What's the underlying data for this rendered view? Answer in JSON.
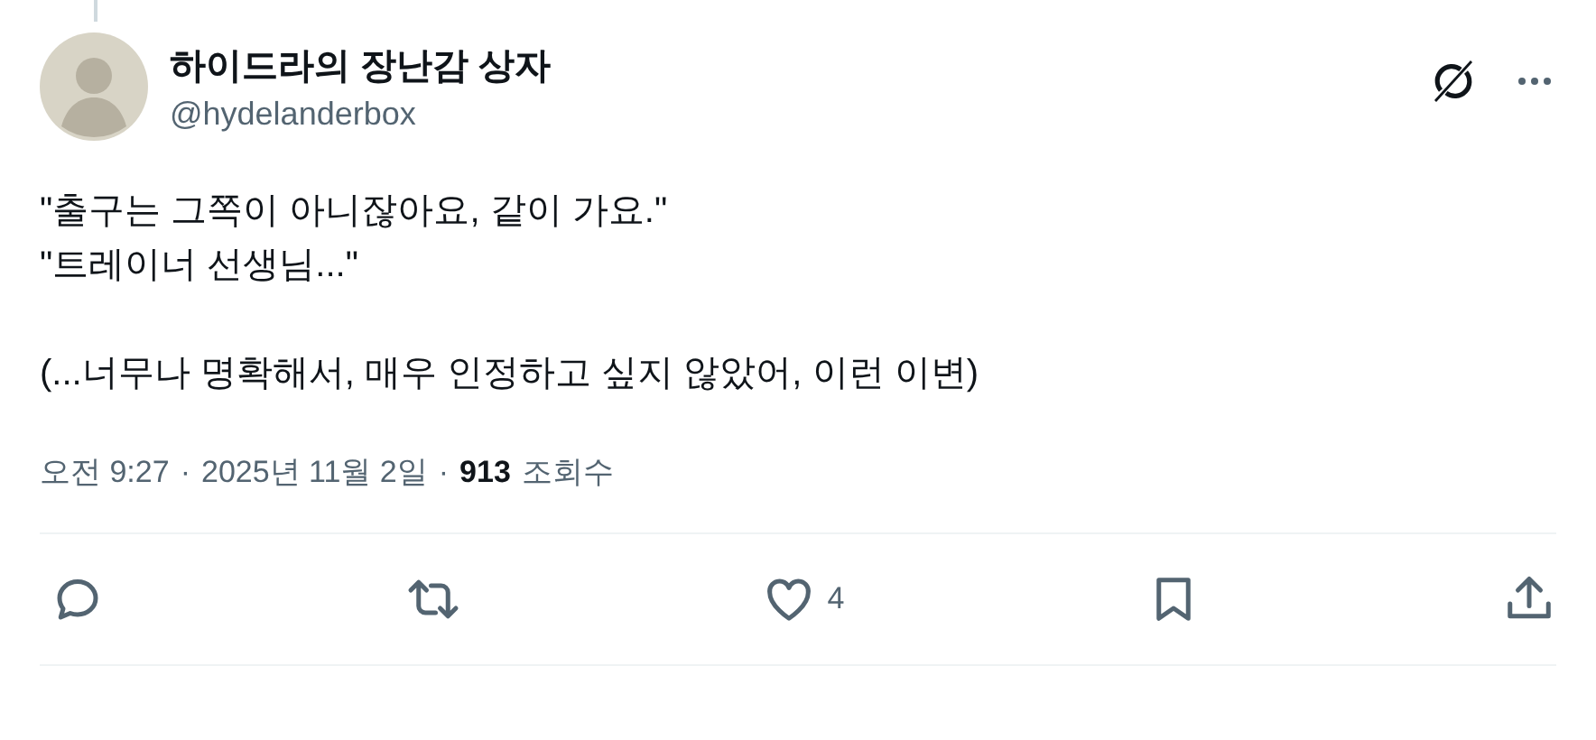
{
  "author": {
    "name": "하이드라의 장난감 상자",
    "handle": "@hydelanderbox"
  },
  "paragraphs": [
    {
      "lines": [
        "\"출구는 그쪽이 아니잖아요, 같이 가요.\"",
        "\"트레이너 선생님...\""
      ]
    },
    {
      "lines": [
        "(...너무나 명확해서, 매우 인정하고 싶지 않았어, 이런 이변)"
      ]
    }
  ],
  "meta": [
    {
      "kind": "text",
      "text": "오전 9:27"
    },
    {
      "kind": "separator",
      "text": "·"
    },
    {
      "kind": "text",
      "text": "2025년 11월 2일"
    },
    {
      "kind": "separator",
      "text": "·"
    },
    {
      "kind": "count",
      "text": "913"
    },
    {
      "kind": "text",
      "text": "조회수"
    }
  ],
  "actions": [
    {
      "kind": "reply"
    },
    {
      "kind": "repost"
    },
    {
      "kind": "like",
      "count": "4"
    },
    {
      "kind": "bookmark"
    },
    {
      "kind": "share"
    }
  ]
}
